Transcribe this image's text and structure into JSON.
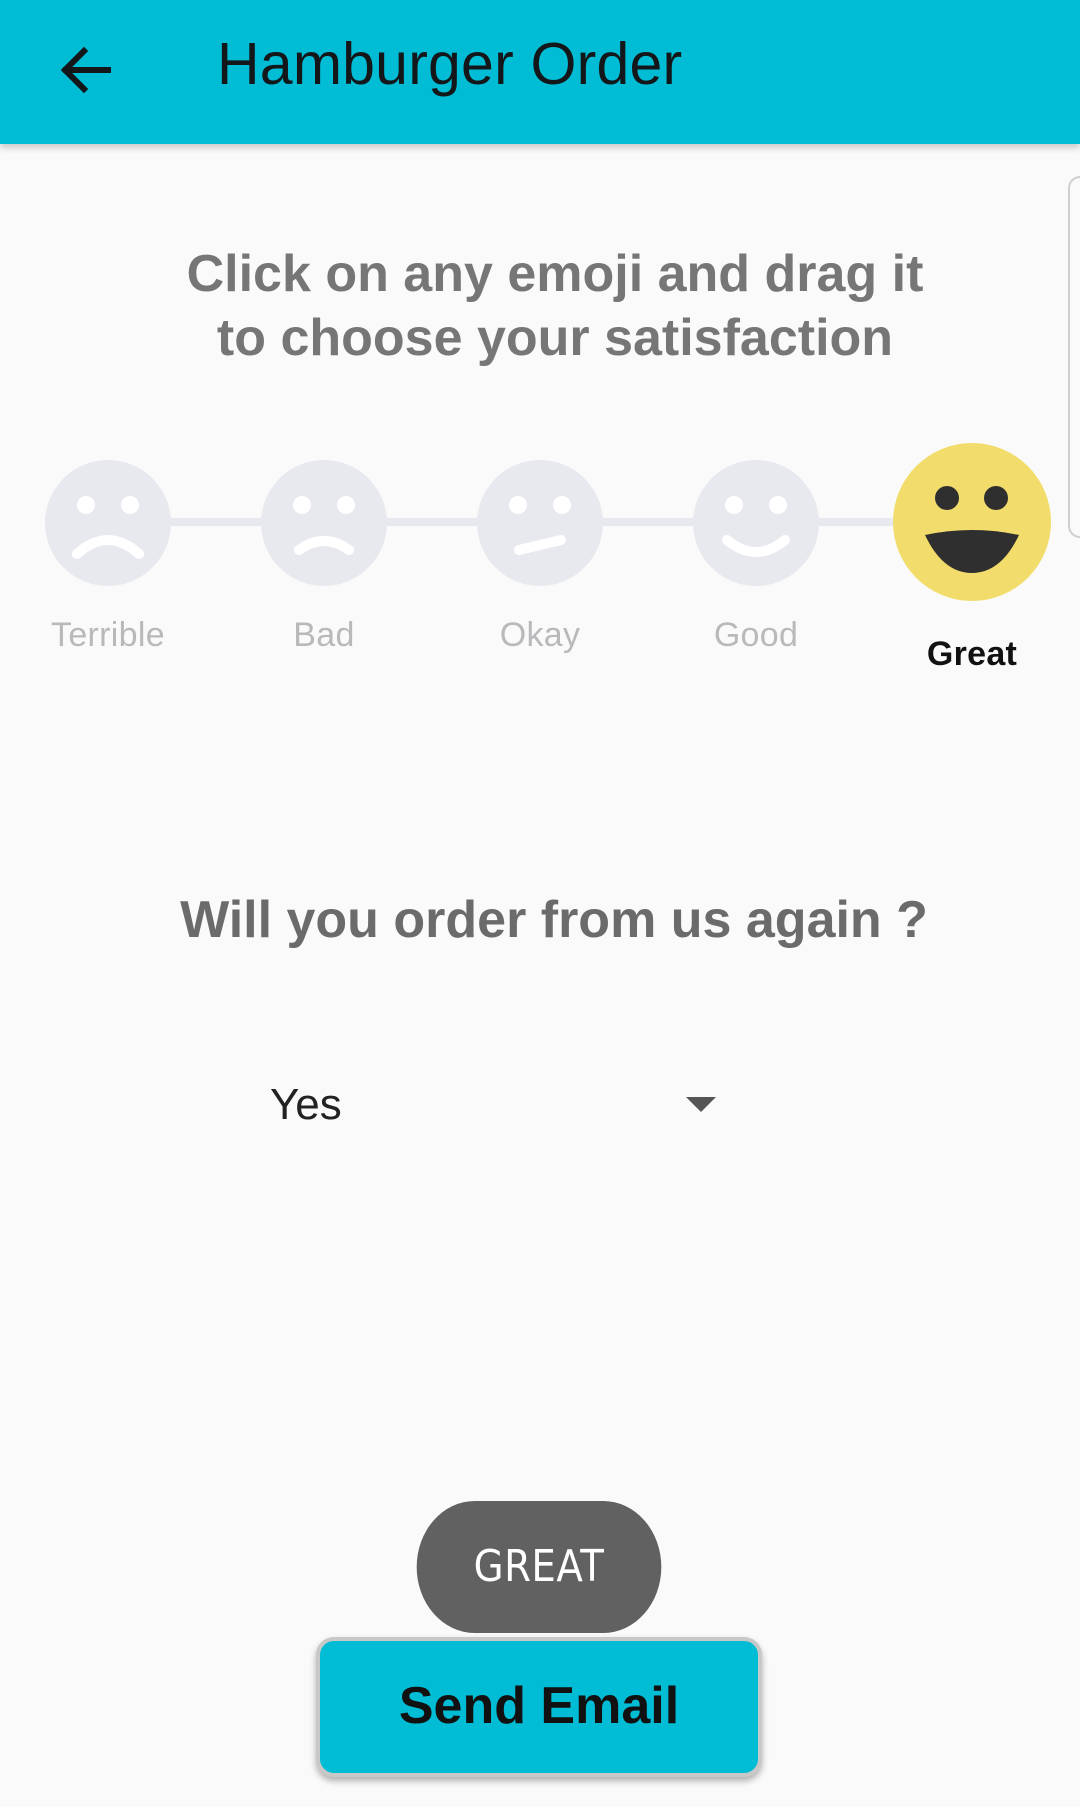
{
  "app": {
    "title": "Hamburger Order",
    "accent_color": "#00bcd4"
  },
  "appbar": {
    "back_icon": "arrow-left-icon"
  },
  "instructions": "Click on any emoji and drag it\nto choose your satisfaction",
  "rating": {
    "options": [
      {
        "label": "Terrible",
        "icon": "face-terrible-icon"
      },
      {
        "label": "Bad",
        "icon": "face-bad-icon"
      },
      {
        "label": "Okay",
        "icon": "face-okay-icon"
      },
      {
        "label": "Good",
        "icon": "face-good-icon"
      },
      {
        "label": "Great",
        "icon": "face-great-icon"
      }
    ],
    "selected": "Great",
    "selected_color": "#f2dc6b",
    "unselected_color": "#e8e9ee"
  },
  "question": "Will you order from us again ?",
  "reorder_select": {
    "value": "Yes"
  },
  "toast": "GREAT",
  "send_button": {
    "label": "Send Email"
  }
}
